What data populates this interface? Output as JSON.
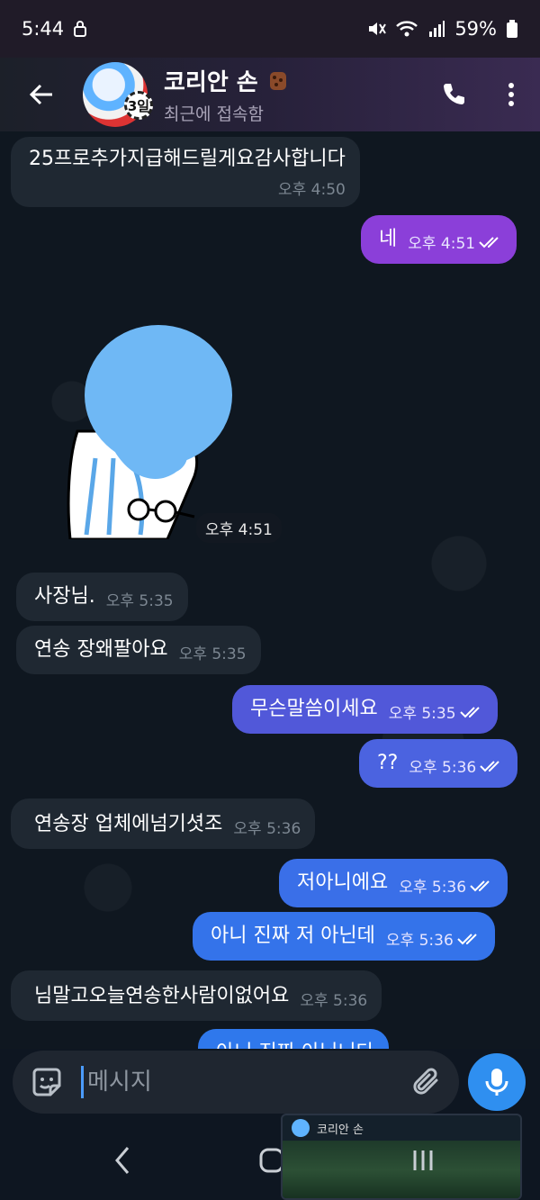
{
  "status_bar": {
    "time": "5:44",
    "battery": "59%",
    "icons": [
      "lock-icon",
      "mute-icon",
      "wifi-icon",
      "signal-icon",
      "battery-icon"
    ]
  },
  "header": {
    "title": "코리안 손",
    "subtitle": "최근에 접속함",
    "story_badge": "3일",
    "icons": [
      "back-arrow-icon",
      "phone-icon",
      "more-vertical-icon"
    ]
  },
  "messages": [
    {
      "direction": "in",
      "text": "25프로추가지급해드릴게요감사합니다",
      "time": "오후 4:50"
    },
    {
      "direction": "out",
      "text": "네",
      "time": "오후 4:51",
      "read": true
    },
    {
      "direction": "in",
      "type": "sticker",
      "time": "오후 4:51"
    },
    {
      "direction": "in",
      "text": "사장님.",
      "time": "오후 5:35"
    },
    {
      "direction": "in",
      "text": "연송 장왜팔아요",
      "time": "오후 5:35"
    },
    {
      "direction": "out",
      "text": "무슨말씀이세요",
      "time": "오후 5:35",
      "read": true
    },
    {
      "direction": "out",
      "text": "??",
      "time": "오후 5:36",
      "read": true
    },
    {
      "direction": "in",
      "text": "연송장 업체에넘기셧조",
      "time": "오후 5:36"
    },
    {
      "direction": "out",
      "text": "저아니에요",
      "time": "오후 5:36",
      "read": true
    },
    {
      "direction": "out",
      "text": "아니 진짜 저 아닌데",
      "time": "오후 5:36",
      "read": true
    },
    {
      "direction": "in",
      "text": "님말고오늘연송한사람이없어요",
      "time": "오후 5:36"
    },
    {
      "direction": "out",
      "text": "아니 진짜 아닙니다",
      "time": ""
    }
  ],
  "composer": {
    "placeholder": "메시지",
    "icons": [
      "sticker-icon",
      "paperclip-icon",
      "microphone-icon"
    ]
  },
  "pip_preview": {
    "title": "코리안 손"
  },
  "colors": {
    "incoming_bubble": "#1f2832",
    "outgoing_purple": "#8b3fd9",
    "outgoing_blue": "#3a6fe8",
    "accent": "#2f8ff0"
  }
}
